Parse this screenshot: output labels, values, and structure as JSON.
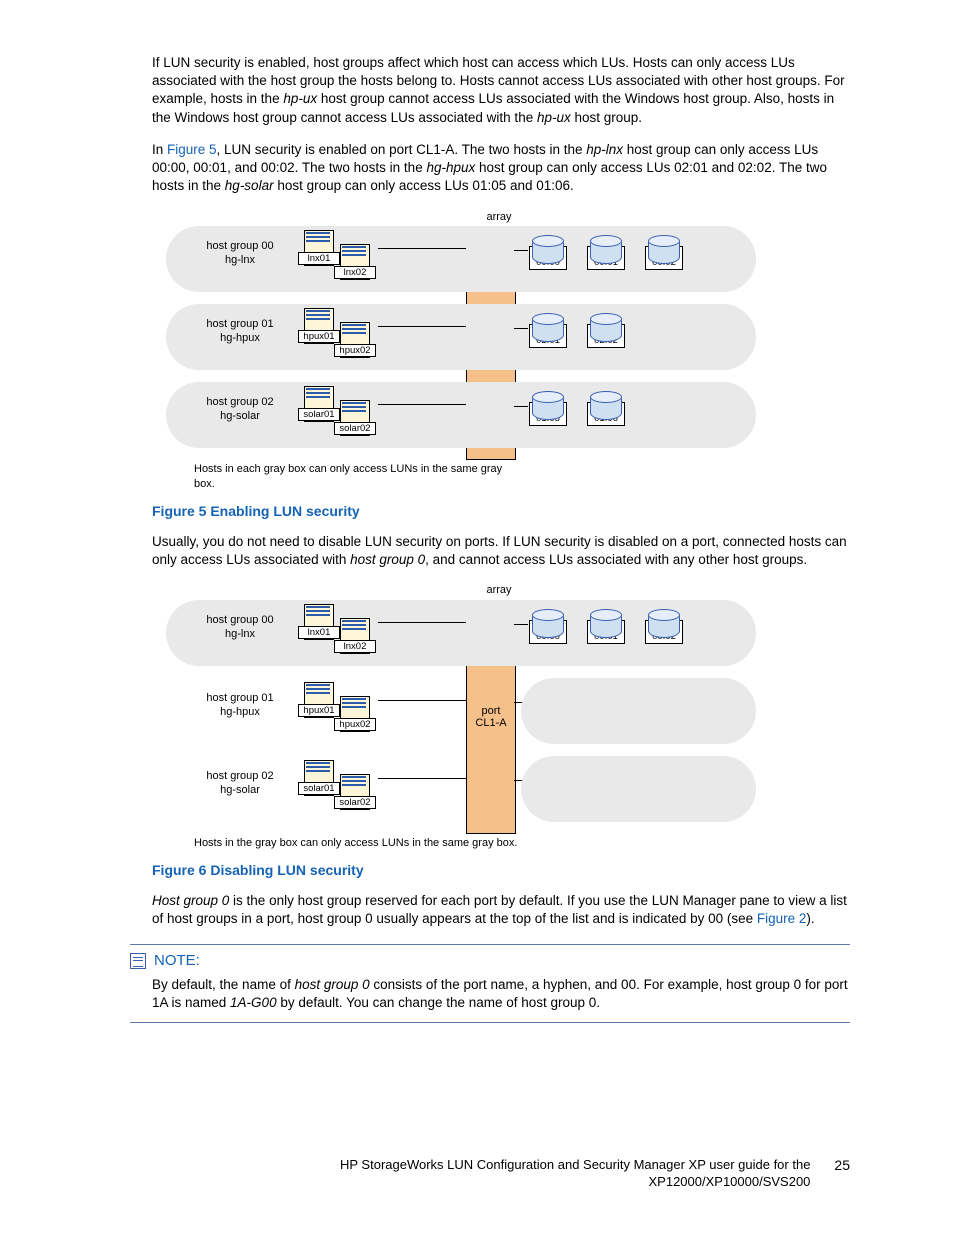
{
  "paragraphs": {
    "p1a": "If LUN security is enabled, host groups affect which host can access which LUs. Hosts can only access LUs associated with the host group the hosts belong to. Hosts cannot access LUs associated with other host groups. For example, hosts in the ",
    "p1_hpux1": "hp-ux",
    "p1b": " host group cannot access LUs associated with the Windows host group. Also, hosts in the Windows host group cannot access LUs associated with the ",
    "p1_hpux2": "hp-ux",
    "p1c": " host group.",
    "p2a": "In ",
    "p2_link": "Figure 5",
    "p2b": ", LUN security is enabled on port CL1-A. The two hosts in the ",
    "p2_hplnx": "hp-lnx",
    "p2c": " host group can only access LUs 00:00, 00:01, and 00:02. The two hosts in the ",
    "p2_hghpux": "hg-hpux",
    "p2d": " host group can only access LUs 02:01 and 02:02. The two hosts in the ",
    "p2_hgsolar": "hg-solar",
    "p2e": " host group can only access LUs 01:05 and 01:06.",
    "fig5": "Figure 5 Enabling LUN security",
    "p3a": "Usually, you do not need to disable LUN security on ports. If LUN security is disabled on a port, connected hosts can only access LUs associated with ",
    "p3_hg0": "host group 0",
    "p3b": ", and cannot access LUs associated with any other host groups.",
    "fig6": "Figure 6 Disabling LUN security",
    "p4_hg0": "Host group 0",
    "p4a": " is the only host group reserved for each port by default. If you use the LUN Manager pane to view a list of host groups in a port, host group 0 usually appears at the top of the list and is indicated by 00 (see ",
    "p4_link": "Figure 2",
    "p4b": ")."
  },
  "note": {
    "title": "NOTE:",
    "body_a": "By default, the name of ",
    "body_hg0": "host group 0",
    "body_b": " consists of the port name, a hyphen, and 00. For example, host group 0 for port 1A is named ",
    "body_1a": "1A-G00",
    "body_c": " by default. You can change the name of host group 0."
  },
  "diagram": {
    "array": "array",
    "port1": "port",
    "port2": "CL1-A",
    "note5": "Hosts in each gray box can only access LUNs in the same gray box.",
    "note6": "Hosts in the gray box can only access LUNs in the same gray box.",
    "rows": [
      {
        "hg_a": "host group 00",
        "hg_b": "hg-lnx",
        "hosts": [
          "lnx01",
          "lnx02"
        ],
        "luns": [
          {
            "t1": "LUN0",
            "t2": "00:00"
          },
          {
            "t1": "LUN1",
            "t2": "00:01"
          },
          {
            "t1": "LUN2",
            "t2": "00:02"
          }
        ]
      },
      {
        "hg_a": "host group 01",
        "hg_b": "hg-hpux",
        "hosts": [
          "hpux01",
          "hpux02"
        ],
        "luns": [
          {
            "t1": "LUN0",
            "t2": "02:01"
          },
          {
            "t1": "LUN1",
            "t2": "02:02"
          }
        ]
      },
      {
        "hg_a": "host group 02",
        "hg_b": "hg-solar",
        "hosts": [
          "solar01",
          "solar02"
        ],
        "luns": [
          {
            "t1": "LUN0",
            "t2": "01:05"
          },
          {
            "t1": "LUN1",
            "t2": "01:06"
          }
        ]
      }
    ]
  },
  "footer": {
    "text_a": "HP StorageWorks LUN Configuration and Security Manager XP user guide for the",
    "text_b": "XP12000/XP10000/SVS200",
    "page": "25"
  }
}
